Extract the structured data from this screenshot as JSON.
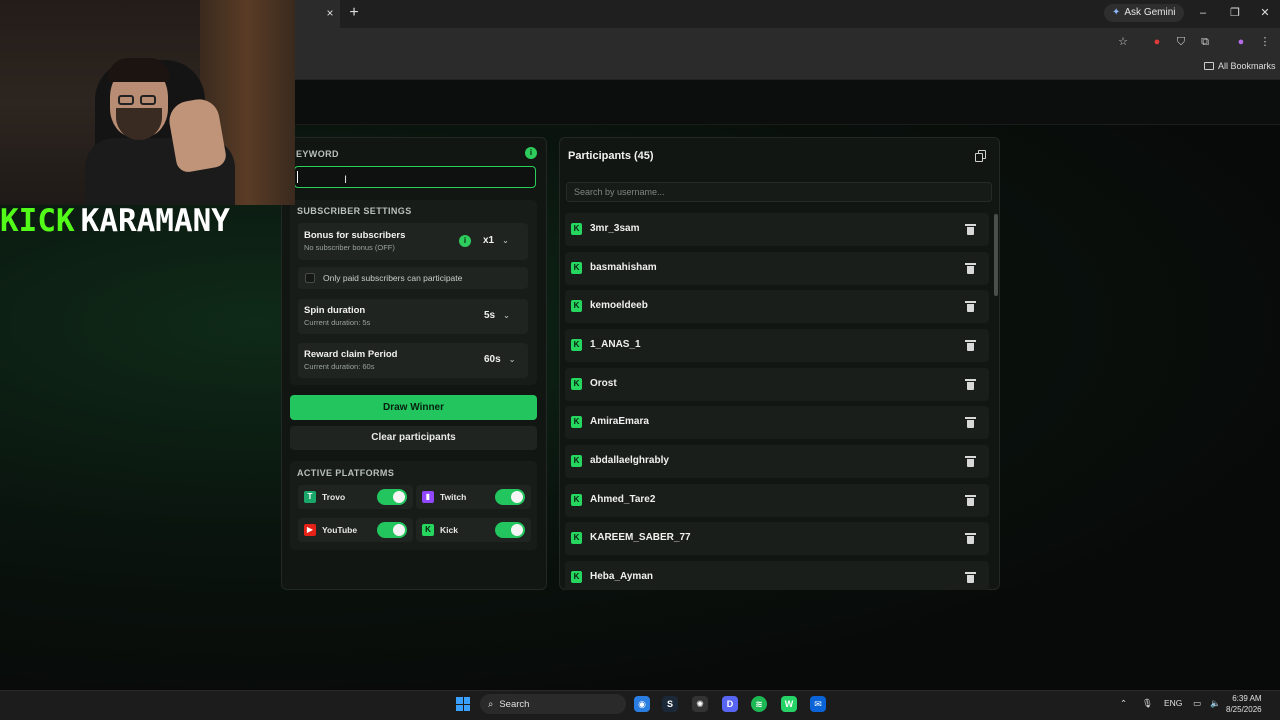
{
  "browser": {
    "ask_gemini": "Ask Gemini",
    "all_bookmarks": "All Bookmarks",
    "tab_close": "×",
    "new_tab": "+"
  },
  "overlay": {
    "kick_word": "KICK",
    "streamer_word": "KARAMANY",
    "kick_color": "#53fc18"
  },
  "keyword": {
    "label": "EYWORD",
    "value": ""
  },
  "subscriber": {
    "section_label": "SUBSCRIBER SETTINGS",
    "bonus_title": "Bonus for subscribers",
    "bonus_sub": "No subscriber bonus (OFF)",
    "bonus_value": "x1",
    "paid_only_label": "Only paid subscribers can participate",
    "paid_only_checked": false,
    "spin_title": "Spin duration",
    "spin_sub": "Current duration: 5s",
    "spin_value": "5s",
    "reward_title": "Reward claim Period",
    "reward_sub": "Current duration: 60s",
    "reward_value": "60s"
  },
  "actions": {
    "draw": "Draw Winner",
    "clear": "Clear participants",
    "accent": "#22c55e"
  },
  "platforms": {
    "section_label": "ACTIVE PLATFORMS",
    "items": [
      {
        "name": "Trovo",
        "icon": "trovo-icon",
        "enabled": true
      },
      {
        "name": "Twitch",
        "icon": "twitch-icon",
        "enabled": true
      },
      {
        "name": "YouTube",
        "icon": "youtube-icon",
        "enabled": true
      },
      {
        "name": "Kick",
        "icon": "kick-icon",
        "enabled": true
      }
    ]
  },
  "participants": {
    "title": "Participants (45)",
    "search_placeholder": "Search by username...",
    "list": [
      "3mr_3sam",
      "basmahisham",
      "kemoeldeeb",
      "1_ANAS_1",
      "Orost",
      "AmiraEmara",
      "abdallaelghrably",
      "Ahmed_Tare2",
      "KAREEM_SABER_77",
      "Heba_Ayman"
    ]
  },
  "taskbar": {
    "search": "Search",
    "lang": "ENG",
    "time": "6:39 AM",
    "date": "8/25/2026"
  }
}
